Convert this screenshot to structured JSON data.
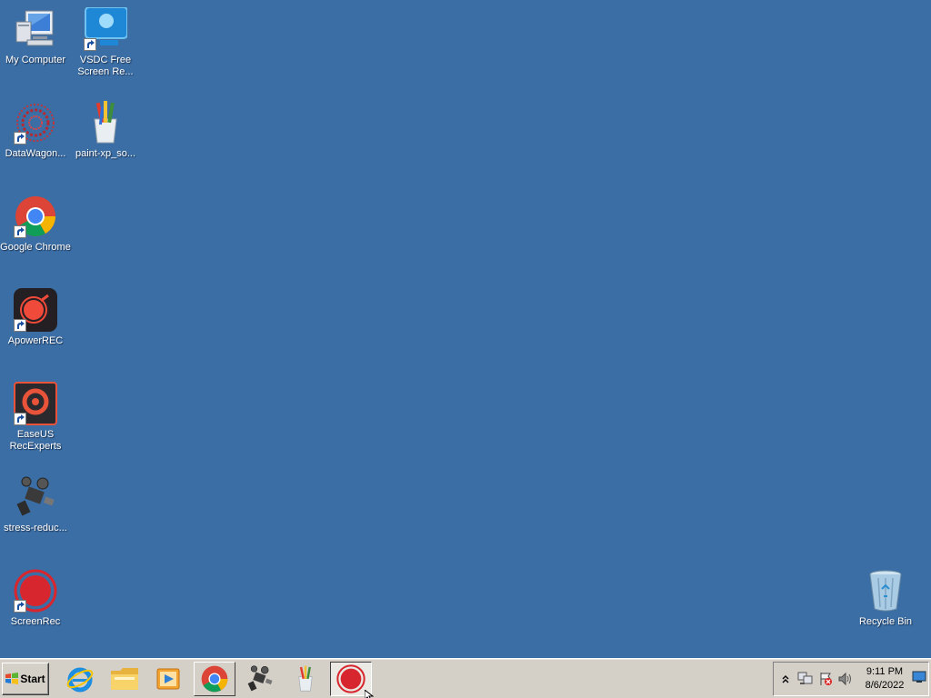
{
  "desktop": {
    "background_color": "#3a6ea5",
    "icons": [
      {
        "label": "My Computer",
        "icon": "my-computer-icon",
        "shortcut": false
      },
      {
        "label": "VSDC Free\nScreen Re...",
        "icon": "vsdc-icon",
        "shortcut": true
      },
      {
        "label": "DataWagon...",
        "icon": "datawagon-icon",
        "shortcut": true
      },
      {
        "label": "paint-xp_so...",
        "icon": "paint-icon",
        "shortcut": false
      },
      {
        "label": "Google Chrome",
        "icon": "chrome-icon",
        "shortcut": true
      },
      {
        "label": "ApowerREC",
        "icon": "apowerrec-icon",
        "shortcut": true
      },
      {
        "label": "EaseUS\nRecExperts",
        "icon": "easeus-icon",
        "shortcut": true
      },
      {
        "label": "stress-reduc...",
        "icon": "camera-icon",
        "shortcut": false
      },
      {
        "label": "ScreenRec",
        "icon": "screenrec-icon",
        "shortcut": true
      },
      {
        "label": "Recycle Bin",
        "icon": "recycle-bin-icon",
        "shortcut": false
      }
    ]
  },
  "taskbar": {
    "start_label": "Start",
    "buttons": [
      {
        "icon": "internet-explorer-icon"
      },
      {
        "icon": "file-explorer-icon"
      },
      {
        "icon": "media-player-icon"
      },
      {
        "icon": "chrome-icon",
        "state": "raised"
      },
      {
        "icon": "camera-icon"
      },
      {
        "icon": "paint-icon"
      },
      {
        "icon": "screenrec-icon",
        "state": "active"
      }
    ],
    "tray": {
      "icons": [
        "chevron-up-icon",
        "network-icon",
        "action-center-icon",
        "volume-icon"
      ],
      "time": "9:11 PM",
      "date": "8/6/2022"
    }
  }
}
